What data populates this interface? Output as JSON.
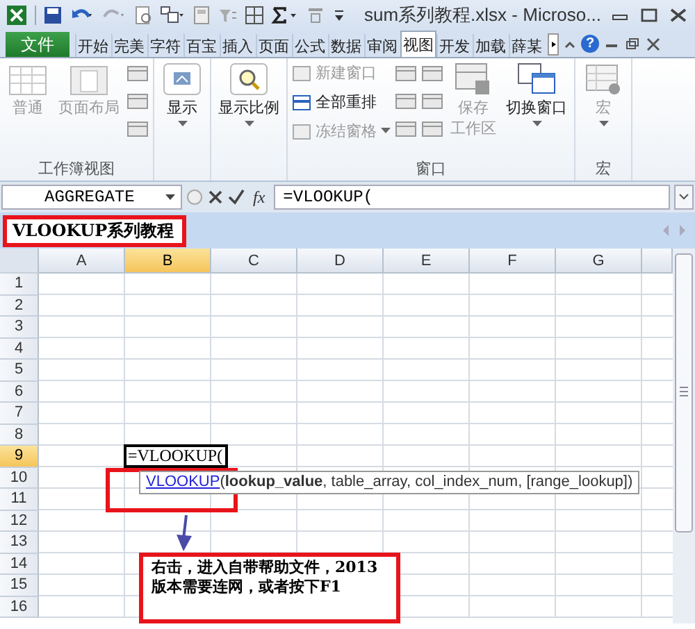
{
  "window": {
    "title": "sum系列教程.xlsx  -  Microso..."
  },
  "tabs": [
    {
      "label": "文件",
      "kind": "file",
      "selected": false
    },
    {
      "label": "开始",
      "kind": "tab",
      "selected": false
    },
    {
      "label": "完美",
      "kind": "tab",
      "selected": false
    },
    {
      "label": "字符",
      "kind": "tab",
      "selected": false
    },
    {
      "label": "百宝",
      "kind": "tab",
      "selected": false
    },
    {
      "label": "插入",
      "kind": "tab",
      "selected": false
    },
    {
      "label": "页面",
      "kind": "tab",
      "selected": false
    },
    {
      "label": "公式",
      "kind": "tab",
      "selected": false
    },
    {
      "label": "数据",
      "kind": "tab",
      "selected": false
    },
    {
      "label": "审阅",
      "kind": "tab",
      "selected": false
    },
    {
      "label": "视图",
      "kind": "tab",
      "selected": true
    },
    {
      "label": "开发",
      "kind": "tab",
      "selected": false
    },
    {
      "label": "加载",
      "kind": "tab",
      "selected": false
    },
    {
      "label": "薛某",
      "kind": "tab",
      "selected": false
    }
  ],
  "help": {
    "label": "?"
  },
  "ribbon_groups": [
    {
      "label": "工作簿视图",
      "items": [
        {
          "kind": "large",
          "lines": [
            "普通"
          ],
          "disabled": true,
          "dropdown": false
        },
        {
          "kind": "large",
          "lines": [
            "页面布局"
          ],
          "disabled": true,
          "dropdown": false
        },
        {
          "kind": "icon_column"
        }
      ]
    },
    {
      "items": [
        {
          "kind": "large",
          "lines": [
            "显示"
          ],
          "disabled": false,
          "dropdown": true
        }
      ]
    },
    {
      "items": [
        {
          "kind": "large",
          "lines": [
            "显示比例"
          ],
          "disabled": false,
          "dropdown": true
        }
      ]
    },
    {
      "label": "窗口",
      "items": [
        {
          "kind": "stack",
          "entries": [
            {
              "label": "新建窗口",
              "disabled": true,
              "dropdown": false
            },
            {
              "label": "全部重排",
              "disabled": false,
              "dropdown": false
            },
            {
              "label": "冻结窗格",
              "disabled": true,
              "dropdown": true
            }
          ]
        },
        {
          "kind": "icon_column"
        },
        {
          "kind": "icon_column"
        },
        {
          "kind": "large",
          "lines": [
            "保存",
            "工作区"
          ],
          "disabled": true,
          "dropdown": false
        },
        {
          "kind": "large",
          "lines": [
            "切换窗口"
          ],
          "disabled": false,
          "dropdown": true
        }
      ]
    },
    {
      "label": "宏",
      "items": [
        {
          "kind": "large",
          "lines": [
            "宏"
          ],
          "disabled": true,
          "dropdown": true
        }
      ]
    }
  ],
  "formula_bar": {
    "name_box": "AGGREGATE",
    "function_button": "fx",
    "formula": "=VLOOKUP("
  },
  "banner_note": "VLOOKUP系列教程",
  "sheet": {
    "columns": [
      {
        "label": "A",
        "selected": false
      },
      {
        "label": "B",
        "selected": true
      },
      {
        "label": "C",
        "selected": false
      },
      {
        "label": "D",
        "selected": false
      },
      {
        "label": "E",
        "selected": false
      },
      {
        "label": "F",
        "selected": false
      },
      {
        "label": "G",
        "selected": false
      }
    ],
    "rows": [
      {
        "label": "1",
        "selected": false
      },
      {
        "label": "2",
        "selected": false
      },
      {
        "label": "3",
        "selected": false
      },
      {
        "label": "4",
        "selected": false
      },
      {
        "label": "5",
        "selected": false
      },
      {
        "label": "6",
        "selected": false
      },
      {
        "label": "7",
        "selected": false
      },
      {
        "label": "8",
        "selected": false
      },
      {
        "label": "9",
        "selected": true
      },
      {
        "label": "10",
        "selected": false
      },
      {
        "label": "11",
        "selected": false
      },
      {
        "label": "12",
        "selected": false
      },
      {
        "label": "13",
        "selected": false
      },
      {
        "label": "14",
        "selected": false
      },
      {
        "label": "15",
        "selected": false
      },
      {
        "label": "16",
        "selected": false
      }
    ],
    "edit_cell": "=VLOOKUP(",
    "tooltip": {
      "function": "VLOOKUP",
      "arguments": "(**lookup_value**, table_array, col_index_num, [range_lookup])"
    }
  },
  "callout": "右击，进入自带帮助文件，2013版本需要连网，或者按下F1"
}
